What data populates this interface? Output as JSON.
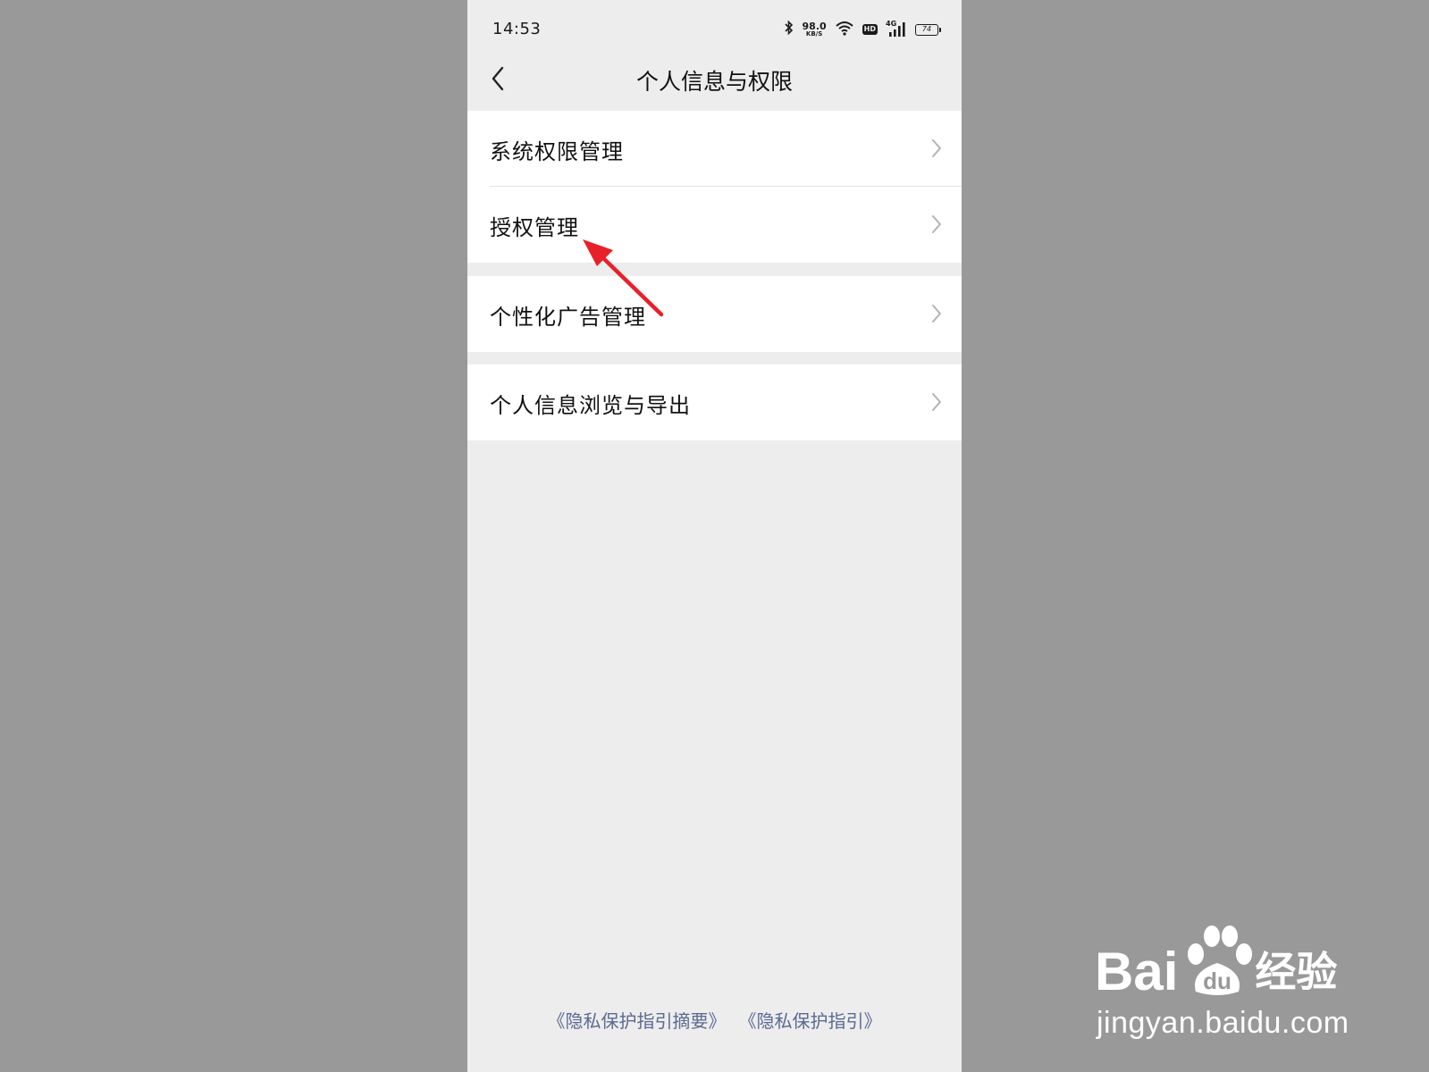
{
  "status_bar": {
    "time": "14:53",
    "net_speed_value": "98.0",
    "net_speed_unit": "KB/S",
    "hd_badge": "HD",
    "signal_label": "4G",
    "battery_level": "74",
    "icons": [
      "bluetooth-icon",
      "wifi-icon",
      "hd-icon",
      "signal-icon",
      "battery-icon"
    ]
  },
  "header": {
    "title": "个人信息与权限",
    "back_icon": "chevron-left-icon"
  },
  "menu_groups": [
    {
      "items": [
        {
          "label": "系统权限管理"
        },
        {
          "label": "授权管理"
        }
      ]
    },
    {
      "items": [
        {
          "label": "个性化广告管理"
        }
      ]
    },
    {
      "items": [
        {
          "label": "个人信息浏览与导出"
        }
      ]
    }
  ],
  "footer": {
    "link_1": "《隐私保护指引摘要》",
    "link_2": "《隐私保护指引》"
  },
  "annotation": {
    "type": "red-arrow",
    "color": "#e8202a"
  },
  "watermark": {
    "brand_left": "Bai",
    "brand_right": "经验",
    "url": "jingyan.baidu.com"
  },
  "colors": {
    "background": "#999999",
    "screen": "#ededed",
    "link": "#5b6a92"
  }
}
